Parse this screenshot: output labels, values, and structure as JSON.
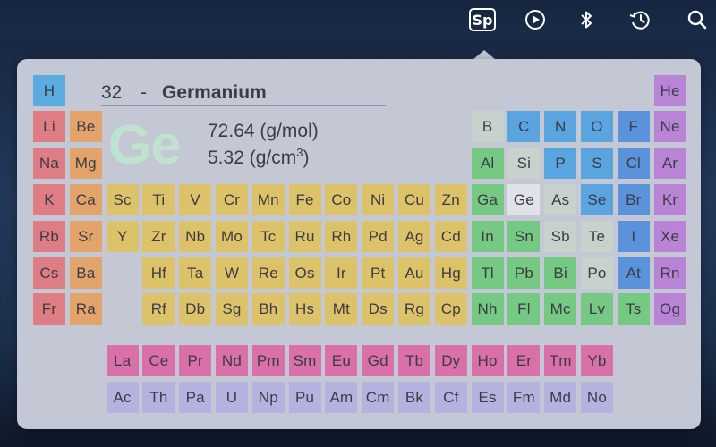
{
  "menubar": {
    "sp_badge_label": "Sp",
    "icons": [
      "play-circle-icon",
      "bluetooth-icon",
      "time-machine-icon",
      "search-icon"
    ]
  },
  "detail": {
    "atomic_number": "32",
    "separator": "-",
    "name": "Germanium",
    "symbol": "Ge",
    "molar_mass": "72.64 (g/mol)",
    "density_prefix": "5.32 (g/cm",
    "density_exp": "3",
    "density_suffix": ")"
  },
  "colors": {
    "hydrogen": "#5aace0",
    "alkali_metal": "#df7d84",
    "alkaline_earth": "#e2a46a",
    "transition_metal": "#dcc268",
    "post_transition": "#dfc86f",
    "metalloid": "#c7d2cc",
    "nonmetal": "#5aa5df",
    "halogen": "#5a93dc",
    "noble_gas": "#b984d5",
    "predicted_metal": "#75c983",
    "lanthanide": "#d970a8",
    "actinide": "#b4b3df",
    "selected": "#dfe3e7",
    "big_symbol": "#bfe3ce"
  },
  "elements": [
    {
      "s": "H",
      "r": 1,
      "c": 1,
      "cat": "h"
    },
    {
      "s": "He",
      "r": 1,
      "c": 18,
      "cat": "ng"
    },
    {
      "s": "Li",
      "r": 2,
      "c": 1,
      "cat": "alk"
    },
    {
      "s": "Be",
      "r": 2,
      "c": 2,
      "cat": "ae"
    },
    {
      "s": "B",
      "r": 2,
      "c": 13,
      "cat": "ml"
    },
    {
      "s": "C",
      "r": 2,
      "c": 14,
      "cat": "nm"
    },
    {
      "s": "N",
      "r": 2,
      "c": 15,
      "cat": "nm"
    },
    {
      "s": "O",
      "r": 2,
      "c": 16,
      "cat": "nm"
    },
    {
      "s": "F",
      "r": 2,
      "c": 17,
      "cat": "hal"
    },
    {
      "s": "Ne",
      "r": 2,
      "c": 18,
      "cat": "ng"
    },
    {
      "s": "Na",
      "r": 3,
      "c": 1,
      "cat": "alk"
    },
    {
      "s": "Mg",
      "r": 3,
      "c": 2,
      "cat": "ae"
    },
    {
      "s": "Al",
      "r": 3,
      "c": 13,
      "cat": "pm"
    },
    {
      "s": "Si",
      "r": 3,
      "c": 14,
      "cat": "ml"
    },
    {
      "s": "P",
      "r": 3,
      "c": 15,
      "cat": "nm"
    },
    {
      "s": "S",
      "r": 3,
      "c": 16,
      "cat": "nm"
    },
    {
      "s": "Cl",
      "r": 3,
      "c": 17,
      "cat": "hal"
    },
    {
      "s": "Ar",
      "r": 3,
      "c": 18,
      "cat": "ng"
    },
    {
      "s": "K",
      "r": 4,
      "c": 1,
      "cat": "alk"
    },
    {
      "s": "Ca",
      "r": 4,
      "c": 2,
      "cat": "ae"
    },
    {
      "s": "Sc",
      "r": 4,
      "c": 3,
      "cat": "tm"
    },
    {
      "s": "Ti",
      "r": 4,
      "c": 4,
      "cat": "tm"
    },
    {
      "s": "V",
      "r": 4,
      "c": 5,
      "cat": "tm"
    },
    {
      "s": "Cr",
      "r": 4,
      "c": 6,
      "cat": "tm"
    },
    {
      "s": "Mn",
      "r": 4,
      "c": 7,
      "cat": "tm"
    },
    {
      "s": "Fe",
      "r": 4,
      "c": 8,
      "cat": "tm"
    },
    {
      "s": "Co",
      "r": 4,
      "c": 9,
      "cat": "tm"
    },
    {
      "s": "Ni",
      "r": 4,
      "c": 10,
      "cat": "tm"
    },
    {
      "s": "Cu",
      "r": 4,
      "c": 11,
      "cat": "tm"
    },
    {
      "s": "Zn",
      "r": 4,
      "c": 12,
      "cat": "tm"
    },
    {
      "s": "Ga",
      "r": 4,
      "c": 13,
      "cat": "pm"
    },
    {
      "s": "Ge",
      "r": 4,
      "c": 14,
      "cat": "sel"
    },
    {
      "s": "As",
      "r": 4,
      "c": 15,
      "cat": "ml"
    },
    {
      "s": "Se",
      "r": 4,
      "c": 16,
      "cat": "nm"
    },
    {
      "s": "Br",
      "r": 4,
      "c": 17,
      "cat": "hal"
    },
    {
      "s": "Kr",
      "r": 4,
      "c": 18,
      "cat": "ng"
    },
    {
      "s": "Rb",
      "r": 5,
      "c": 1,
      "cat": "alk"
    },
    {
      "s": "Sr",
      "r": 5,
      "c": 2,
      "cat": "ae"
    },
    {
      "s": "Y",
      "r": 5,
      "c": 3,
      "cat": "tm"
    },
    {
      "s": "Zr",
      "r": 5,
      "c": 4,
      "cat": "tm"
    },
    {
      "s": "Nb",
      "r": 5,
      "c": 5,
      "cat": "tm"
    },
    {
      "s": "Mo",
      "r": 5,
      "c": 6,
      "cat": "tm"
    },
    {
      "s": "Tc",
      "r": 5,
      "c": 7,
      "cat": "tm"
    },
    {
      "s": "Ru",
      "r": 5,
      "c": 8,
      "cat": "tm"
    },
    {
      "s": "Rh",
      "r": 5,
      "c": 9,
      "cat": "tm"
    },
    {
      "s": "Pd",
      "r": 5,
      "c": 10,
      "cat": "tm"
    },
    {
      "s": "Ag",
      "r": 5,
      "c": 11,
      "cat": "tm"
    },
    {
      "s": "Cd",
      "r": 5,
      "c": 12,
      "cat": "tm"
    },
    {
      "s": "In",
      "r": 5,
      "c": 13,
      "cat": "pm"
    },
    {
      "s": "Sn",
      "r": 5,
      "c": 14,
      "cat": "pm"
    },
    {
      "s": "Sb",
      "r": 5,
      "c": 15,
      "cat": "ml"
    },
    {
      "s": "Te",
      "r": 5,
      "c": 16,
      "cat": "ml"
    },
    {
      "s": "I",
      "r": 5,
      "c": 17,
      "cat": "hal"
    },
    {
      "s": "Xe",
      "r": 5,
      "c": 18,
      "cat": "ng"
    },
    {
      "s": "Cs",
      "r": 6,
      "c": 1,
      "cat": "alk"
    },
    {
      "s": "Ba",
      "r": 6,
      "c": 2,
      "cat": "ae"
    },
    {
      "s": "Hf",
      "r": 6,
      "c": 4,
      "cat": "tm"
    },
    {
      "s": "Ta",
      "r": 6,
      "c": 5,
      "cat": "tm"
    },
    {
      "s": "W",
      "r": 6,
      "c": 6,
      "cat": "tm"
    },
    {
      "s": "Re",
      "r": 6,
      "c": 7,
      "cat": "tm"
    },
    {
      "s": "Os",
      "r": 6,
      "c": 8,
      "cat": "tm"
    },
    {
      "s": "Ir",
      "r": 6,
      "c": 9,
      "cat": "tm"
    },
    {
      "s": "Pt",
      "r": 6,
      "c": 10,
      "cat": "tm"
    },
    {
      "s": "Au",
      "r": 6,
      "c": 11,
      "cat": "tm"
    },
    {
      "s": "Hg",
      "r": 6,
      "c": 12,
      "cat": "tm"
    },
    {
      "s": "Tl",
      "r": 6,
      "c": 13,
      "cat": "pm"
    },
    {
      "s": "Pb",
      "r": 6,
      "c": 14,
      "cat": "pm"
    },
    {
      "s": "Bi",
      "r": 6,
      "c": 15,
      "cat": "pm"
    },
    {
      "s": "Po",
      "r": 6,
      "c": 16,
      "cat": "ml"
    },
    {
      "s": "At",
      "r": 6,
      "c": 17,
      "cat": "hal"
    },
    {
      "s": "Rn",
      "r": 6,
      "c": 18,
      "cat": "ng"
    },
    {
      "s": "Fr",
      "r": 7,
      "c": 1,
      "cat": "alk"
    },
    {
      "s": "Ra",
      "r": 7,
      "c": 2,
      "cat": "ae"
    },
    {
      "s": "Rf",
      "r": 7,
      "c": 4,
      "cat": "tm"
    },
    {
      "s": "Db",
      "r": 7,
      "c": 5,
      "cat": "tm"
    },
    {
      "s": "Sg",
      "r": 7,
      "c": 6,
      "cat": "tm"
    },
    {
      "s": "Bh",
      "r": 7,
      "c": 7,
      "cat": "tm"
    },
    {
      "s": "Hs",
      "r": 7,
      "c": 8,
      "cat": "tm"
    },
    {
      "s": "Mt",
      "r": 7,
      "c": 9,
      "cat": "tm"
    },
    {
      "s": "Ds",
      "r": 7,
      "c": 10,
      "cat": "tm"
    },
    {
      "s": "Rg",
      "r": 7,
      "c": 11,
      "cat": "tm"
    },
    {
      "s": "Cp",
      "r": 7,
      "c": 12,
      "cat": "tm"
    },
    {
      "s": "Nh",
      "r": 7,
      "c": 13,
      "cat": "pm"
    },
    {
      "s": "Fl",
      "r": 7,
      "c": 14,
      "cat": "pm"
    },
    {
      "s": "Mc",
      "r": 7,
      "c": 15,
      "cat": "pm"
    },
    {
      "s": "Lv",
      "r": 7,
      "c": 16,
      "cat": "pm"
    },
    {
      "s": "Ts",
      "r": 7,
      "c": 17,
      "cat": "pm"
    },
    {
      "s": "Og",
      "r": 7,
      "c": 18,
      "cat": "ng"
    },
    {
      "s": "La",
      "r": 9,
      "c": 3,
      "cat": "lan"
    },
    {
      "s": "Ce",
      "r": 9,
      "c": 4,
      "cat": "lan"
    },
    {
      "s": "Pr",
      "r": 9,
      "c": 5,
      "cat": "lan"
    },
    {
      "s": "Nd",
      "r": 9,
      "c": 6,
      "cat": "lan"
    },
    {
      "s": "Pm",
      "r": 9,
      "c": 7,
      "cat": "lan"
    },
    {
      "s": "Sm",
      "r": 9,
      "c": 8,
      "cat": "lan"
    },
    {
      "s": "Eu",
      "r": 9,
      "c": 9,
      "cat": "lan"
    },
    {
      "s": "Gd",
      "r": 9,
      "c": 10,
      "cat": "lan"
    },
    {
      "s": "Tb",
      "r": 9,
      "c": 11,
      "cat": "lan"
    },
    {
      "s": "Dy",
      "r": 9,
      "c": 12,
      "cat": "lan"
    },
    {
      "s": "Ho",
      "r": 9,
      "c": 13,
      "cat": "lan"
    },
    {
      "s": "Er",
      "r": 9,
      "c": 14,
      "cat": "lan"
    },
    {
      "s": "Tm",
      "r": 9,
      "c": 15,
      "cat": "lan"
    },
    {
      "s": "Yb",
      "r": 9,
      "c": 16,
      "cat": "lan"
    },
    {
      "s": "Ac",
      "r": 10,
      "c": 3,
      "cat": "act"
    },
    {
      "s": "Th",
      "r": 10,
      "c": 4,
      "cat": "act"
    },
    {
      "s": "Pa",
      "r": 10,
      "c": 5,
      "cat": "act"
    },
    {
      "s": "U",
      "r": 10,
      "c": 6,
      "cat": "act"
    },
    {
      "s": "Np",
      "r": 10,
      "c": 7,
      "cat": "act"
    },
    {
      "s": "Pu",
      "r": 10,
      "c": 8,
      "cat": "act"
    },
    {
      "s": "Am",
      "r": 10,
      "c": 9,
      "cat": "act"
    },
    {
      "s": "Cm",
      "r": 10,
      "c": 10,
      "cat": "act"
    },
    {
      "s": "Bk",
      "r": 10,
      "c": 11,
      "cat": "act"
    },
    {
      "s": "Cf",
      "r": 10,
      "c": 12,
      "cat": "act"
    },
    {
      "s": "Es",
      "r": 10,
      "c": 13,
      "cat": "act"
    },
    {
      "s": "Fm",
      "r": 10,
      "c": 14,
      "cat": "act"
    },
    {
      "s": "Md",
      "r": 10,
      "c": 15,
      "cat": "act"
    },
    {
      "s": "No",
      "r": 10,
      "c": 16,
      "cat": "act"
    }
  ]
}
